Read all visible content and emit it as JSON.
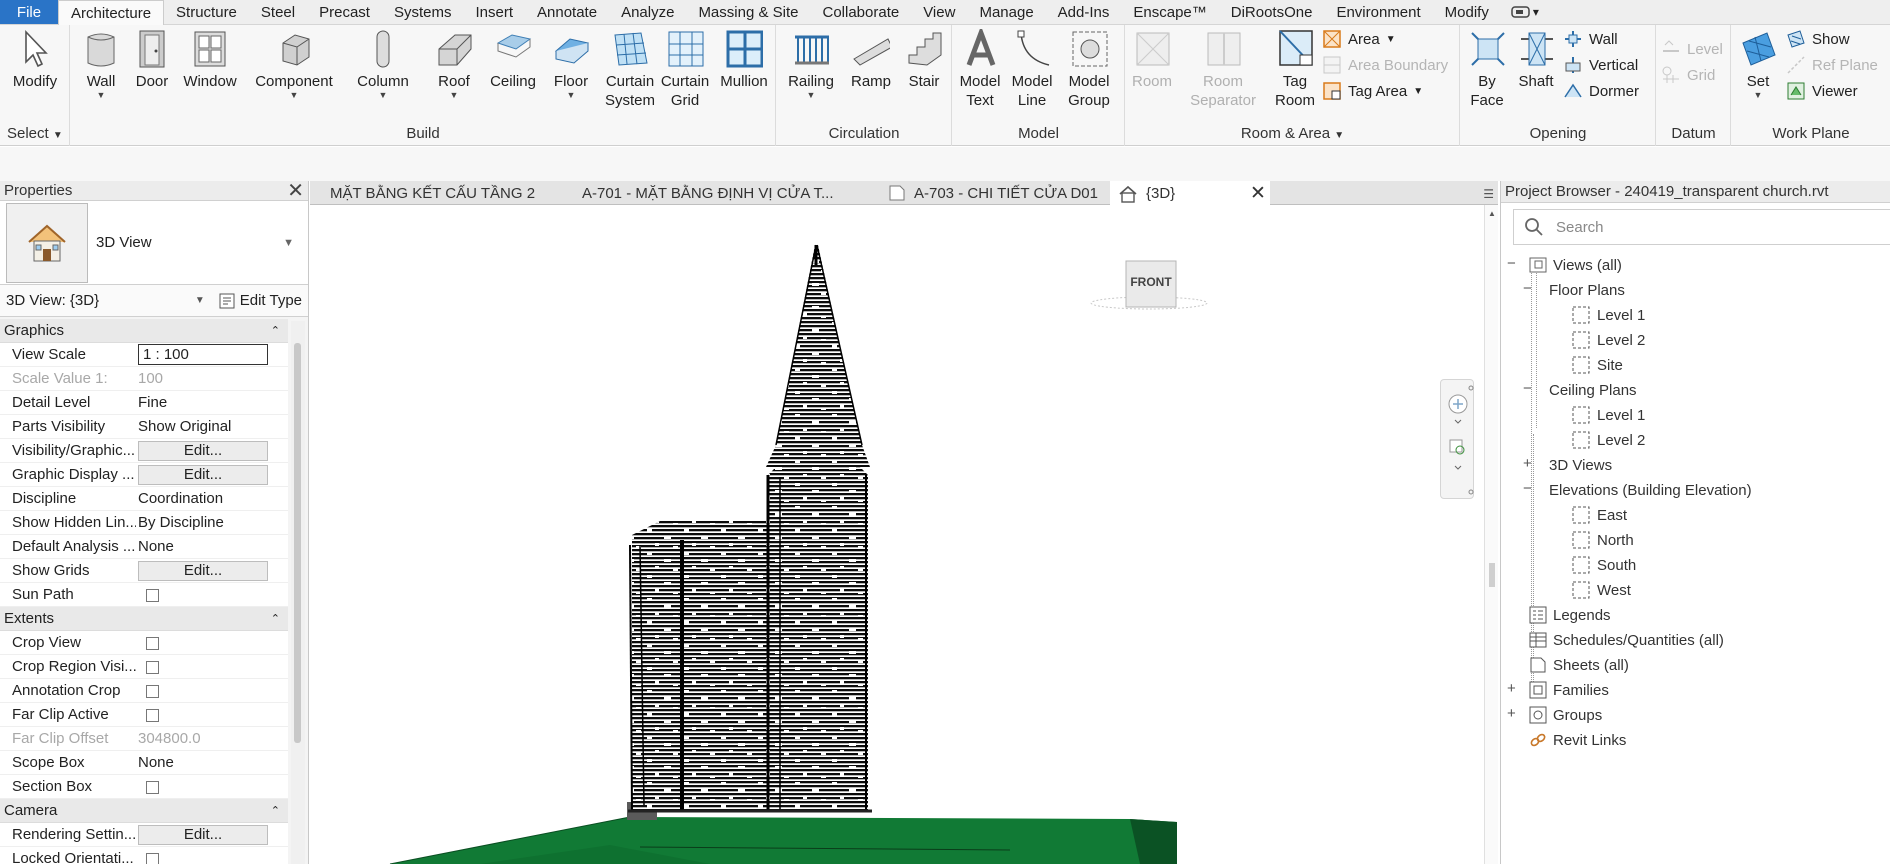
{
  "menu": {
    "file": "File",
    "tabs": [
      "Architecture",
      "Structure",
      "Steel",
      "Precast",
      "Systems",
      "Insert",
      "Annotate",
      "Analyze",
      "Massing & Site",
      "Collaborate",
      "View",
      "Manage",
      "Add-Ins",
      "Enscape™",
      "DiRootsOne",
      "Environment",
      "Modify"
    ],
    "active": "Architecture"
  },
  "ribbon": {
    "select": {
      "modify": "Modify",
      "label": "Select"
    },
    "build": {
      "wall": "Wall",
      "door": "Door",
      "window": "Window",
      "component": "Component",
      "column": "Column",
      "roof": "Roof",
      "ceiling": "Ceiling",
      "floor": "Floor",
      "curtain_system": "Curtain System",
      "curtain_grid": "Curtain Grid",
      "mullion": "Mullion",
      "label": "Build"
    },
    "circulation": {
      "railing": "Railing",
      "ramp": "Ramp",
      "stair": "Stair",
      "label": "Circulation"
    },
    "model": {
      "model_text": "Model Text",
      "model_line": "Model Line",
      "model_group": "Model Group",
      "label": "Model"
    },
    "room_area": {
      "room": "Room",
      "room_separator": "Room Separator",
      "tag_room": "Tag Room",
      "area": "Area",
      "area_boundary": "Area Boundary",
      "tag_area": "Tag Area",
      "label": "Room & Area"
    },
    "opening": {
      "by_face": "By Face",
      "shaft": "Shaft",
      "wall": "Wall",
      "vertical": "Vertical",
      "dormer": "Dormer",
      "label": "Opening"
    },
    "datum": {
      "level": "Level",
      "grid": "Grid",
      "label": "Datum"
    },
    "work_plane": {
      "set": "Set",
      "show": "Show",
      "ref_plane": "Ref Plane",
      "viewer": "Viewer",
      "label": "Work Plane"
    }
  },
  "properties": {
    "title": "Properties",
    "type_name": "3D View",
    "instance": "3D View: {3D}",
    "edit_type": "Edit Type",
    "groups": [
      {
        "name": "Graphics",
        "rows": [
          {
            "name": "View Scale",
            "value": "1 : 100",
            "kind": "box"
          },
          {
            "name": "Scale Value    1:",
            "value": "100",
            "kind": "dim"
          },
          {
            "name": "Detail Level",
            "value": "Fine",
            "kind": "text"
          },
          {
            "name": "Parts Visibility",
            "value": "Show Original",
            "kind": "text"
          },
          {
            "name": "Visibility/Graphic...",
            "value": "Edit...",
            "kind": "button"
          },
          {
            "name": "Graphic Display ...",
            "value": "Edit...",
            "kind": "button"
          },
          {
            "name": "Discipline",
            "value": "Coordination",
            "kind": "text"
          },
          {
            "name": "Show Hidden Lin...",
            "value": "By Discipline",
            "kind": "text"
          },
          {
            "name": "Default Analysis ...",
            "value": "None",
            "kind": "text"
          },
          {
            "name": "Show Grids",
            "value": "Edit...",
            "kind": "button"
          },
          {
            "name": "Sun Path",
            "value": "",
            "kind": "check"
          }
        ]
      },
      {
        "name": "Extents",
        "rows": [
          {
            "name": "Crop View",
            "value": "",
            "kind": "check"
          },
          {
            "name": "Crop Region Visi...",
            "value": "",
            "kind": "check"
          },
          {
            "name": "Annotation Crop",
            "value": "",
            "kind": "check"
          },
          {
            "name": "Far Clip Active",
            "value": "",
            "kind": "check"
          },
          {
            "name": "Far Clip Offset",
            "value": "304800.0",
            "kind": "dim"
          },
          {
            "name": "Scope Box",
            "value": "None",
            "kind": "text"
          },
          {
            "name": "Section Box",
            "value": "",
            "kind": "check"
          }
        ]
      },
      {
        "name": "Camera",
        "rows": [
          {
            "name": "Rendering Settin...",
            "value": "Edit...",
            "kind": "button"
          },
          {
            "name": "Locked Orientati...",
            "value": "",
            "kind": "check"
          }
        ]
      }
    ]
  },
  "view_tabs": [
    {
      "label": "MẶT BẰNG KẾT CẤU TẦNG 2",
      "icon": "plan"
    },
    {
      "label": "A-701 - MẶT BẰNG ĐỊNH VỊ CỬA T...",
      "icon": "sheet"
    },
    {
      "label": "A-703 - CHI TIẾT CỬA D01",
      "icon": "sheet"
    },
    {
      "label": "{3D}",
      "icon": "house",
      "active": true
    }
  ],
  "viewcube_label": "FRONT",
  "browser": {
    "title": "Project Browser - 240419_transparent church.rvt",
    "search_placeholder": "Search",
    "nodes": {
      "views": "Views (all)",
      "floor_plans": "Floor Plans",
      "fp_level1": "Level 1",
      "fp_level2": "Level 2",
      "fp_site": "Site",
      "ceiling_plans": "Ceiling Plans",
      "cp_level1": "Level 1",
      "cp_level2": "Level 2",
      "views3d": "3D Views",
      "elevations": "Elevations (Building Elevation)",
      "east": "East",
      "north": "North",
      "south": "South",
      "west": "West",
      "legends": "Legends",
      "schedules": "Schedules/Quantities (all)",
      "sheets": "Sheets (all)",
      "families": "Families",
      "groups": "Groups",
      "revit_links": "Revit Links"
    }
  },
  "colors": {
    "file_tab": "#2a74c7",
    "ground": "#117a35",
    "accent": "#2a74c7"
  }
}
